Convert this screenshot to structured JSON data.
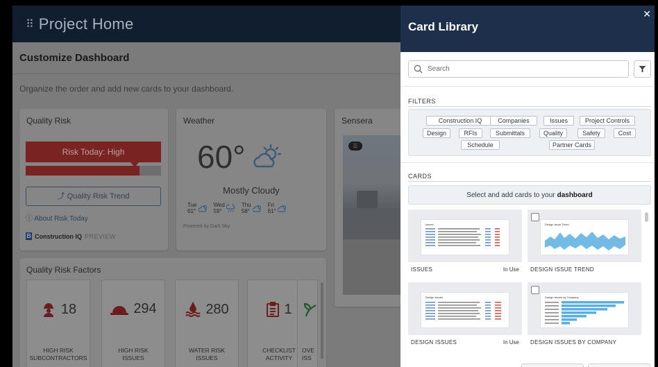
{
  "header": {
    "title": "Project Home"
  },
  "customize": {
    "title": "Customize Dashboard",
    "subtitle": "Organize the order and add new cards to your dashboard."
  },
  "quality_risk": {
    "title": "Quality Risk",
    "risk_label": "Risk Today: High",
    "risk_level": 0.84,
    "trend_button": "Quality Risk Trend",
    "about_link": "About Risk Today",
    "brand": "Construction IQ",
    "preview": "PREVIEW"
  },
  "weather": {
    "title": "Weather",
    "temp": "60°",
    "condition": "Mostly Cloudy",
    "forecast": [
      {
        "day": "Tue",
        "temp": "61°",
        "icon": "partly-cloudy-icon"
      },
      {
        "day": "Wed",
        "temp": "59°",
        "icon": "rain-icon"
      },
      {
        "day": "Thu",
        "temp": "58°",
        "icon": "partly-cloudy-icon"
      },
      {
        "day": "Fri",
        "temp": "61°",
        "icon": "partly-cloudy-icon"
      }
    ],
    "powered": "Powered by Dark Sky"
  },
  "sensera": {
    "title": "Sensera"
  },
  "quality_factors": {
    "title": "Quality Risk Factors",
    "tiles": [
      {
        "value": "18",
        "line1": "HIGH RISK",
        "line2": "SUBCONTRACTORS",
        "icon": "worker-icon"
      },
      {
        "value": "294",
        "line1": "HIGH RISK",
        "line2": "ISSUES",
        "icon": "hardhat-icon"
      },
      {
        "value": "280",
        "line1": "WATER RISK",
        "line2": "ISSUES",
        "icon": "water-icon"
      },
      {
        "value": "1",
        "line1": "CHECKLIST",
        "line2": "ACTIVITY",
        "icon": "clipboard-icon"
      },
      {
        "value": "",
        "line1": "OVE",
        "line2": "ISS",
        "icon": "leaf-icon"
      }
    ]
  },
  "panel": {
    "title": "Card Library",
    "search_placeholder": "Search",
    "filters_heading": "FILTERS",
    "filters": [
      "Construction IQ",
      "Companies",
      "Issues",
      "Project Controls",
      "Design",
      "RFIs",
      "Submittals",
      "Quality",
      "Safety",
      "Cost",
      "Schedule",
      "Partner Cards"
    ],
    "cards_heading": "CARDS",
    "select_prefix": "Select and add cards to your",
    "select_bold": "dashboard",
    "cards": [
      {
        "label": "ISSUES",
        "status": "In Use",
        "thumb_title": "Issues"
      },
      {
        "label": "DESIGN ISSUE TREND",
        "status": "",
        "thumb_title": "Design Issue Trend"
      },
      {
        "label": "DESIGN ISSUES",
        "status": "In Use",
        "thumb_title": "Design Issues"
      },
      {
        "label": "DESIGN ISSUES BY COMPANY",
        "status": "",
        "thumb_title": "Design Issues by Company"
      }
    ]
  },
  "colors": {
    "panel_header": "#1d2f4b",
    "risk_red": "#7a2323",
    "link_blue": "#304259",
    "chart_blue": "#5aaee0"
  }
}
